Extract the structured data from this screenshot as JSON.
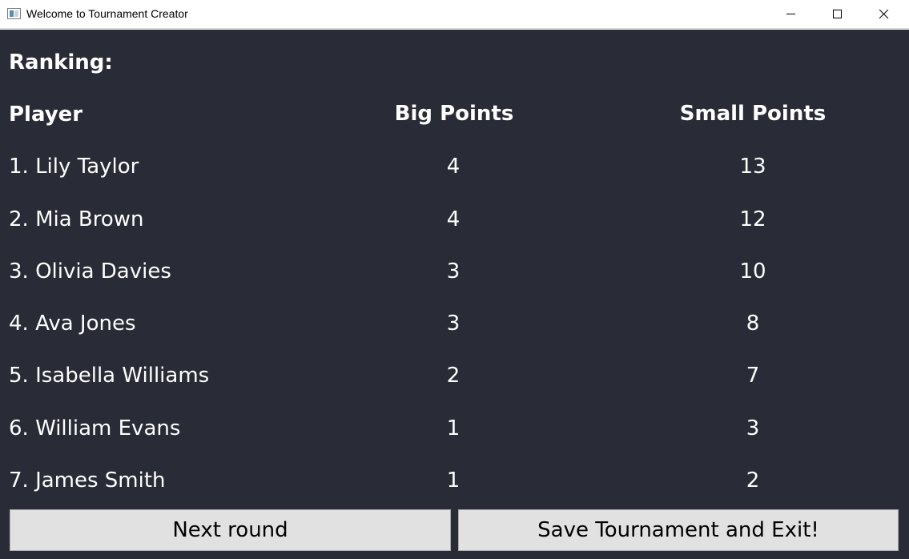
{
  "window": {
    "title": "Welcome to Tournament Creator"
  },
  "ranking": {
    "heading": "Ranking:",
    "columns": {
      "player": "Player",
      "big_points": "Big Points",
      "small_points": "Small Points"
    },
    "rows": [
      {
        "name": "1. Lily Taylor",
        "big": "4",
        "small": "13"
      },
      {
        "name": "2. Mia Brown",
        "big": "4",
        "small": "12"
      },
      {
        "name": "3. Olivia Davies",
        "big": "3",
        "small": "10"
      },
      {
        "name": "4. Ava Jones",
        "big": "3",
        "small": "8"
      },
      {
        "name": "5. Isabella Williams",
        "big": "2",
        "small": "7"
      },
      {
        "name": "6. William Evans",
        "big": "1",
        "small": "3"
      },
      {
        "name": "7. James Smith",
        "big": "1",
        "small": "2"
      }
    ]
  },
  "buttons": {
    "next_round": "Next round",
    "save_exit": "Save Tournament and Exit!"
  },
  "colors": {
    "background": "#292c36",
    "text": "#ffffff",
    "button": "#e1e1e1"
  },
  "icons": {
    "app": "app-window-icon",
    "minimize": "minimize-icon",
    "maximize": "maximize-icon",
    "close": "close-icon"
  }
}
